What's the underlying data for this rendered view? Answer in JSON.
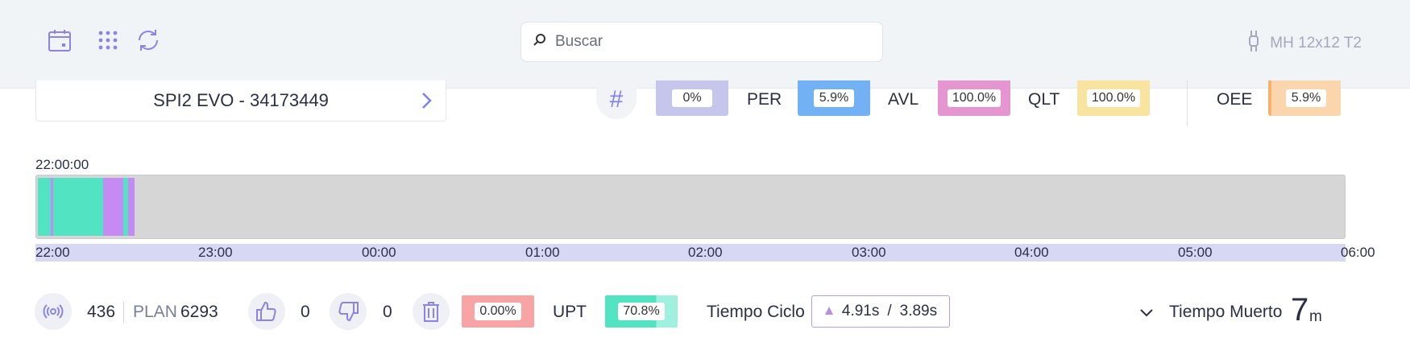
{
  "topbar": {
    "icons": [
      "calendar-icon",
      "grid-icon",
      "refresh-icon"
    ],
    "search_placeholder": "Buscar",
    "device_name": "MH 12x12 T2"
  },
  "machine": {
    "name": "SPI2 EVO - 34173449"
  },
  "kpis": {
    "hash_value": "0%",
    "per_label": "PER",
    "per_value": "5.9%",
    "avl_label": "AVL",
    "avl_value": "100.0%",
    "qlt_label": "QLT",
    "qlt_value": "100.0%",
    "oee_label": "OEE",
    "oee_value": "5.9%"
  },
  "colors": {
    "hash": "#c6c6ec",
    "per": "#72b2f4",
    "avl": "#e595cf",
    "qlt": "#f8e49f",
    "oee": "#fbd5ac",
    "run": "#52e3c2",
    "stop": "#c68bf3",
    "idle": "#d6d6d6",
    "axis": "#d7d8f4",
    "rejected": "#f8a3a4",
    "upt": "#52e3c2",
    "upt_rest": "#9ff0de",
    "accent": "#7f7ff0"
  },
  "timeline": {
    "start_label": "22:00:00",
    "ticks": [
      "22:00",
      "23:00",
      "00:00",
      "01:00",
      "02:00",
      "03:00",
      "04:00",
      "05:00",
      "06:00"
    ]
  },
  "bottom": {
    "count": "436",
    "plan_label": "PLAN",
    "plan_value": "6293",
    "good_count": "0",
    "bad_count": "0",
    "scrap_pct": "0.00%",
    "upt_label": "UPT",
    "upt_value": "70.8%",
    "cycle_label": "Tiempo Ciclo",
    "cycle_value": "4.91s",
    "cycle_sep": "/",
    "cycle_target": "3.89s",
    "dead_label": "Tiempo Muerto",
    "dead_value": "7",
    "dead_unit": "m"
  }
}
